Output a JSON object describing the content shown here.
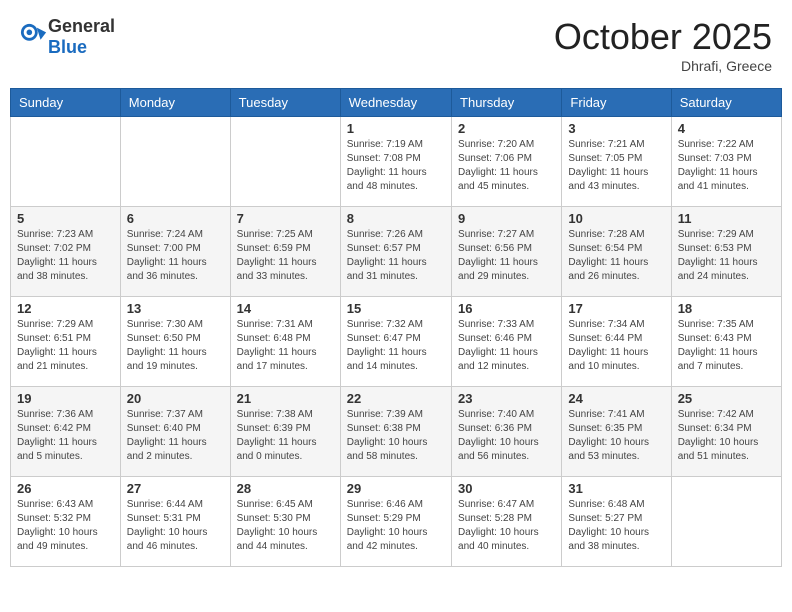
{
  "header": {
    "logo_general": "General",
    "logo_blue": "Blue",
    "month": "October 2025",
    "location": "Dhrafi, Greece"
  },
  "days_of_week": [
    "Sunday",
    "Monday",
    "Tuesday",
    "Wednesday",
    "Thursday",
    "Friday",
    "Saturday"
  ],
  "weeks": [
    [
      {
        "day": "",
        "info": ""
      },
      {
        "day": "",
        "info": ""
      },
      {
        "day": "",
        "info": ""
      },
      {
        "day": "1",
        "info": "Sunrise: 7:19 AM\nSunset: 7:08 PM\nDaylight: 11 hours and 48 minutes."
      },
      {
        "day": "2",
        "info": "Sunrise: 7:20 AM\nSunset: 7:06 PM\nDaylight: 11 hours and 45 minutes."
      },
      {
        "day": "3",
        "info": "Sunrise: 7:21 AM\nSunset: 7:05 PM\nDaylight: 11 hours and 43 minutes."
      },
      {
        "day": "4",
        "info": "Sunrise: 7:22 AM\nSunset: 7:03 PM\nDaylight: 11 hours and 41 minutes."
      }
    ],
    [
      {
        "day": "5",
        "info": "Sunrise: 7:23 AM\nSunset: 7:02 PM\nDaylight: 11 hours and 38 minutes."
      },
      {
        "day": "6",
        "info": "Sunrise: 7:24 AM\nSunset: 7:00 PM\nDaylight: 11 hours and 36 minutes."
      },
      {
        "day": "7",
        "info": "Sunrise: 7:25 AM\nSunset: 6:59 PM\nDaylight: 11 hours and 33 minutes."
      },
      {
        "day": "8",
        "info": "Sunrise: 7:26 AM\nSunset: 6:57 PM\nDaylight: 11 hours and 31 minutes."
      },
      {
        "day": "9",
        "info": "Sunrise: 7:27 AM\nSunset: 6:56 PM\nDaylight: 11 hours and 29 minutes."
      },
      {
        "day": "10",
        "info": "Sunrise: 7:28 AM\nSunset: 6:54 PM\nDaylight: 11 hours and 26 minutes."
      },
      {
        "day": "11",
        "info": "Sunrise: 7:29 AM\nSunset: 6:53 PM\nDaylight: 11 hours and 24 minutes."
      }
    ],
    [
      {
        "day": "12",
        "info": "Sunrise: 7:29 AM\nSunset: 6:51 PM\nDaylight: 11 hours and 21 minutes."
      },
      {
        "day": "13",
        "info": "Sunrise: 7:30 AM\nSunset: 6:50 PM\nDaylight: 11 hours and 19 minutes."
      },
      {
        "day": "14",
        "info": "Sunrise: 7:31 AM\nSunset: 6:48 PM\nDaylight: 11 hours and 17 minutes."
      },
      {
        "day": "15",
        "info": "Sunrise: 7:32 AM\nSunset: 6:47 PM\nDaylight: 11 hours and 14 minutes."
      },
      {
        "day": "16",
        "info": "Sunrise: 7:33 AM\nSunset: 6:46 PM\nDaylight: 11 hours and 12 minutes."
      },
      {
        "day": "17",
        "info": "Sunrise: 7:34 AM\nSunset: 6:44 PM\nDaylight: 11 hours and 10 minutes."
      },
      {
        "day": "18",
        "info": "Sunrise: 7:35 AM\nSunset: 6:43 PM\nDaylight: 11 hours and 7 minutes."
      }
    ],
    [
      {
        "day": "19",
        "info": "Sunrise: 7:36 AM\nSunset: 6:42 PM\nDaylight: 11 hours and 5 minutes."
      },
      {
        "day": "20",
        "info": "Sunrise: 7:37 AM\nSunset: 6:40 PM\nDaylight: 11 hours and 2 minutes."
      },
      {
        "day": "21",
        "info": "Sunrise: 7:38 AM\nSunset: 6:39 PM\nDaylight: 11 hours and 0 minutes."
      },
      {
        "day": "22",
        "info": "Sunrise: 7:39 AM\nSunset: 6:38 PM\nDaylight: 10 hours and 58 minutes."
      },
      {
        "day": "23",
        "info": "Sunrise: 7:40 AM\nSunset: 6:36 PM\nDaylight: 10 hours and 56 minutes."
      },
      {
        "day": "24",
        "info": "Sunrise: 7:41 AM\nSunset: 6:35 PM\nDaylight: 10 hours and 53 minutes."
      },
      {
        "day": "25",
        "info": "Sunrise: 7:42 AM\nSunset: 6:34 PM\nDaylight: 10 hours and 51 minutes."
      }
    ],
    [
      {
        "day": "26",
        "info": "Sunrise: 6:43 AM\nSunset: 5:32 PM\nDaylight: 10 hours and 49 minutes."
      },
      {
        "day": "27",
        "info": "Sunrise: 6:44 AM\nSunset: 5:31 PM\nDaylight: 10 hours and 46 minutes."
      },
      {
        "day": "28",
        "info": "Sunrise: 6:45 AM\nSunset: 5:30 PM\nDaylight: 10 hours and 44 minutes."
      },
      {
        "day": "29",
        "info": "Sunrise: 6:46 AM\nSunset: 5:29 PM\nDaylight: 10 hours and 42 minutes."
      },
      {
        "day": "30",
        "info": "Sunrise: 6:47 AM\nSunset: 5:28 PM\nDaylight: 10 hours and 40 minutes."
      },
      {
        "day": "31",
        "info": "Sunrise: 6:48 AM\nSunset: 5:27 PM\nDaylight: 10 hours and 38 minutes."
      },
      {
        "day": "",
        "info": ""
      }
    ]
  ]
}
